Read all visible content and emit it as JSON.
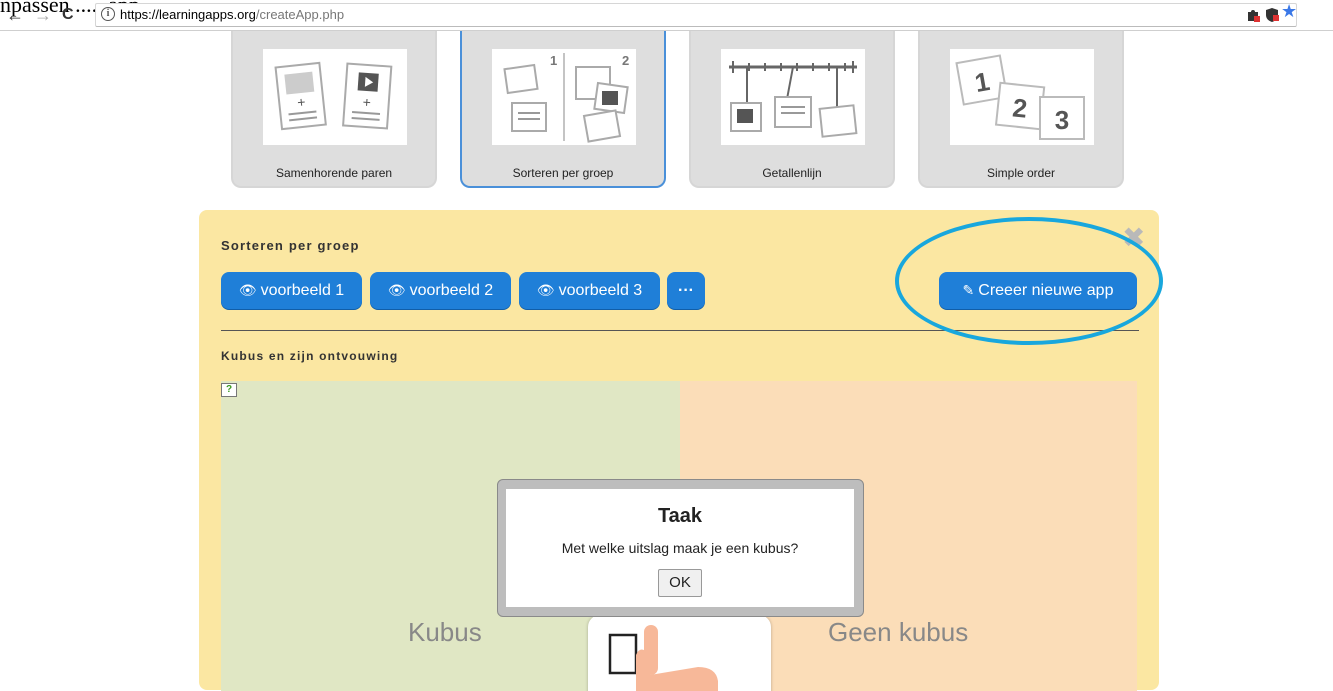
{
  "page_top_text": "npassen ..... app ... ",
  "browser": {
    "back": "←",
    "forward": "→",
    "reload": "C",
    "info": "i",
    "url_host": "https://learningapps.org",
    "url_path": "/createApp.php",
    "star": "★"
  },
  "app_cards": [
    {
      "label": "Samenhorende paren"
    },
    {
      "label": "Sorteren per groep"
    },
    {
      "label": "Getallenlijn"
    },
    {
      "label": "Simple order"
    }
  ],
  "panel": {
    "title": "Sorteren per groep",
    "close": "✖",
    "example_buttons": [
      {
        "label": "voorbeeld 1",
        "icon": "eye-icon"
      },
      {
        "label": "voorbeeld 2",
        "icon": "eye-icon"
      },
      {
        "label": "voorbeeld 3",
        "icon": "eye-icon"
      }
    ],
    "more_label": "···",
    "create_label": "Creeer nieuwe app",
    "create_icon": "pencil-icon",
    "app_title": "Kubus en zijn ontvouwing"
  },
  "app": {
    "left_zone": "Kubus",
    "right_zone": "Geen kubus",
    "help_symbol": "?",
    "dialog": {
      "title": "Taak",
      "text": "Met welke uitslag maak je een kubus?",
      "ok": "OK"
    }
  },
  "colors": {
    "button_blue": "#1f7fd8",
    "panel_yellow": "#fbe7a2",
    "highlight_ring": "#18a7dd",
    "active_card_border": "#4a90d9"
  }
}
